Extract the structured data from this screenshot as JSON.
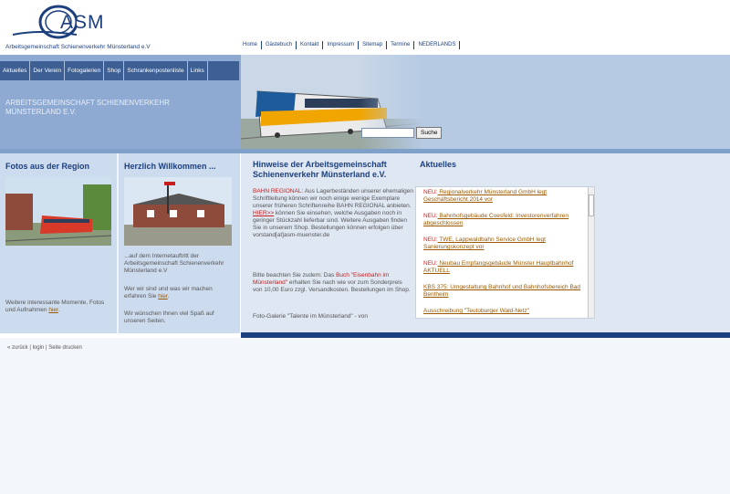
{
  "logo": {
    "text": "ASM",
    "subtitle": "Arbeitsgemeinschaft Schienenverkehr Münsterland e.V"
  },
  "topnav": [
    "Home",
    "Gästebuch",
    "Kontakt",
    "Impressum",
    "Sitemap",
    "Termine",
    "NEDERLANDS"
  ],
  "mainnav": [
    "Aktuelles",
    "Der Verein",
    "Fotogalerien",
    "Shop",
    "Schrankenpostenliste",
    "Links"
  ],
  "band_title": "ARBEITSGEMEINSCHAFT SCHIENENVERKEHR MÜNSTERLAND E.V.",
  "search": {
    "button": "Suche",
    "value": ""
  },
  "col1": {
    "title": "Fotos aus der Region",
    "text": "Weitere interessante Momente, Fotos und Aufnahmen ",
    "link": "hier",
    "after": "."
  },
  "col2": {
    "title": "Herzlich Willkommen ...",
    "p1": "...auf dem Internetauftritt der Arbeitsgemeinschaft Schienenverkehr Münsterland e.V",
    "p2_text": "Wer wir sind und was wir machen erfahren Sie ",
    "p2_link": "hier",
    "p2_after": ".",
    "p3": "Wir wünschen Ihnen viel Spaß auf unseren Seiten."
  },
  "col3": {
    "title": "Hinweise der Arbeitsgemeinschaft Schienenverkehr Münsterland e.V.",
    "p1_red": "BAHN REGIONAL:",
    "p1_text": " Aus Lagerbeständen unserer ehemaligen Schriftleitung können wir noch einige wenige Exemplare unserer früheren Schriftenreihe BAHN REGIONAL anbieten.",
    "p1_link": "HIER>>",
    "p1_text2": " können Sie einsehen, welche Ausgaben noch in geringer Stückzahl lieferbar sind. Weitere Ausgaben finden Sie in unserem Shop. Bestellungen können erfolgen über vorstand[at]asm-muenster.de",
    "p2_text": "Bitte beachten Sie zudem: Das ",
    "p2_red": "Buch \"Eisenbahn im Münsterland\"",
    "p2_text2": " erhalten Sie nach wie vor zum Sonderpreis von 10,00 Euro zzgl. Versandkosten. Bestellungen im Shop.",
    "p3": "Foto-Galerie \"Talente im Münsterland\" - von"
  },
  "news": {
    "title": "Aktuelles",
    "items": [
      {
        "new": "NEU:",
        "text": " Regionalverkehr Münsterland GmbH legt Geschäftsbericht 2014 vor"
      },
      {
        "new": "NEU:",
        "text": " Bahnhofsgebäude Coesfeld: Investorenverfahren abgeschlossen"
      },
      {
        "new": "NEU:",
        "text": " TWE, Lappwaldbahn Service GmbH legt Sanierungskonzept vor"
      },
      {
        "new": "NEU:",
        "text": " Neubau Empfangsgebäude Münster Hauptbahnhof AKTUELL"
      },
      {
        "new": "",
        "text": "KBS 375: Umgestaltung Bahnhof und Bahnhofsbereich Bad Bentheim"
      },
      {
        "new": "",
        "text": "Ausschreibung \"Teutoburger Wald-Netz\""
      }
    ]
  },
  "footer": {
    "back": "« zurück",
    "login": "login",
    "print": "Seite drucken",
    "sep": "|"
  }
}
